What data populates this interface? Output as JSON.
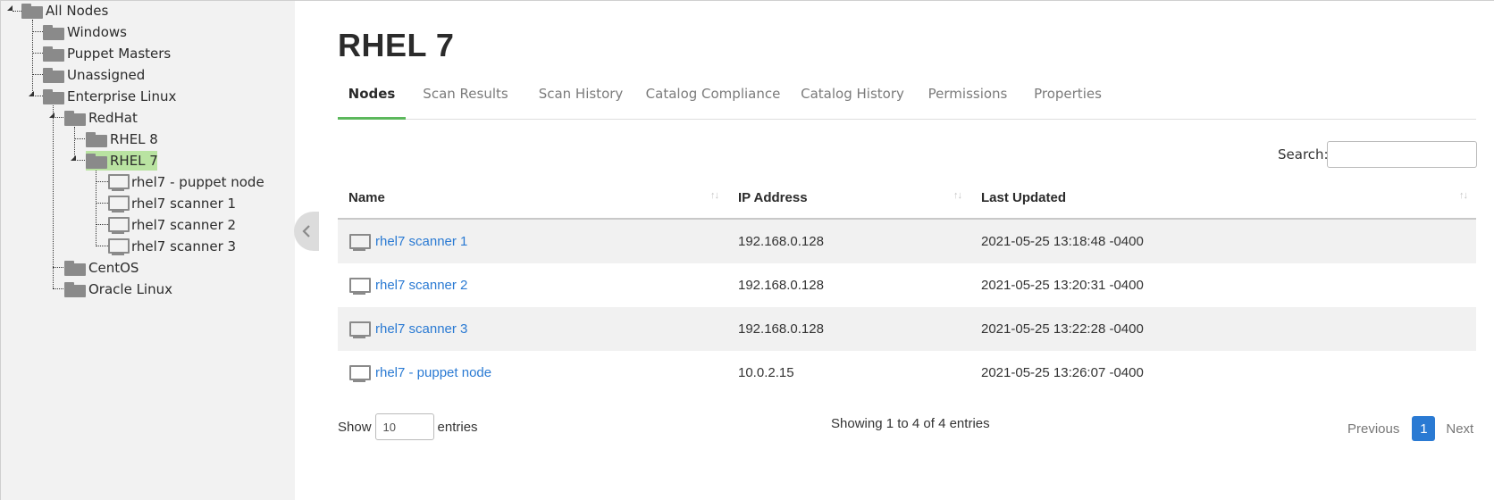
{
  "tree": {
    "root": "All Nodes",
    "windows": "Windows",
    "puppet_masters": "Puppet Masters",
    "unassigned": "Unassigned",
    "enterprise_linux": "Enterprise Linux",
    "redhat": "RedHat",
    "rhel8": "RHEL 8",
    "rhel7": "RHEL 7",
    "node_puppet": "rhel7 - puppet node",
    "node_scanner1": "rhel7 scanner 1",
    "node_scanner2": "rhel7 scanner 2",
    "node_scanner3": "rhel7 scanner 3",
    "centos": "CentOS",
    "oracle": "Oracle Linux"
  },
  "page": {
    "title": "RHEL 7"
  },
  "tabs": {
    "nodes": "Nodes",
    "scan_results": "Scan Results",
    "scan_history": "Scan History",
    "catalog_compliance": "Catalog Compliance",
    "catalog_history": "Catalog History",
    "permissions": "Permissions",
    "properties": "Properties"
  },
  "search": {
    "label": "Search:",
    "value": ""
  },
  "table": {
    "headers": {
      "name": "Name",
      "ip": "IP Address",
      "updated": "Last Updated"
    },
    "sort_glyph": "↑↓",
    "rows": [
      {
        "name": "rhel7 scanner 1",
        "ip": "192.168.0.128",
        "updated": "2021-05-25 13:18:48 -0400"
      },
      {
        "name": "rhel7 scanner 2",
        "ip": "192.168.0.128",
        "updated": "2021-05-25 13:20:31 -0400"
      },
      {
        "name": "rhel7 scanner 3",
        "ip": "192.168.0.128",
        "updated": "2021-05-25 13:22:28 -0400"
      },
      {
        "name": "rhel7 - puppet node",
        "ip": "10.0.2.15",
        "updated": "2021-05-25 13:26:07 -0400"
      }
    ]
  },
  "footer": {
    "show_label": "Show",
    "entries_value": "10",
    "entries_label": "entries",
    "info": "Showing 1 to 4 of 4 entries",
    "previous": "Previous",
    "page": "1",
    "next": "Next"
  },
  "colors": {
    "accent": "#5cb85c",
    "link": "#2a7ad3",
    "selected_node": "#b9e3a1"
  }
}
